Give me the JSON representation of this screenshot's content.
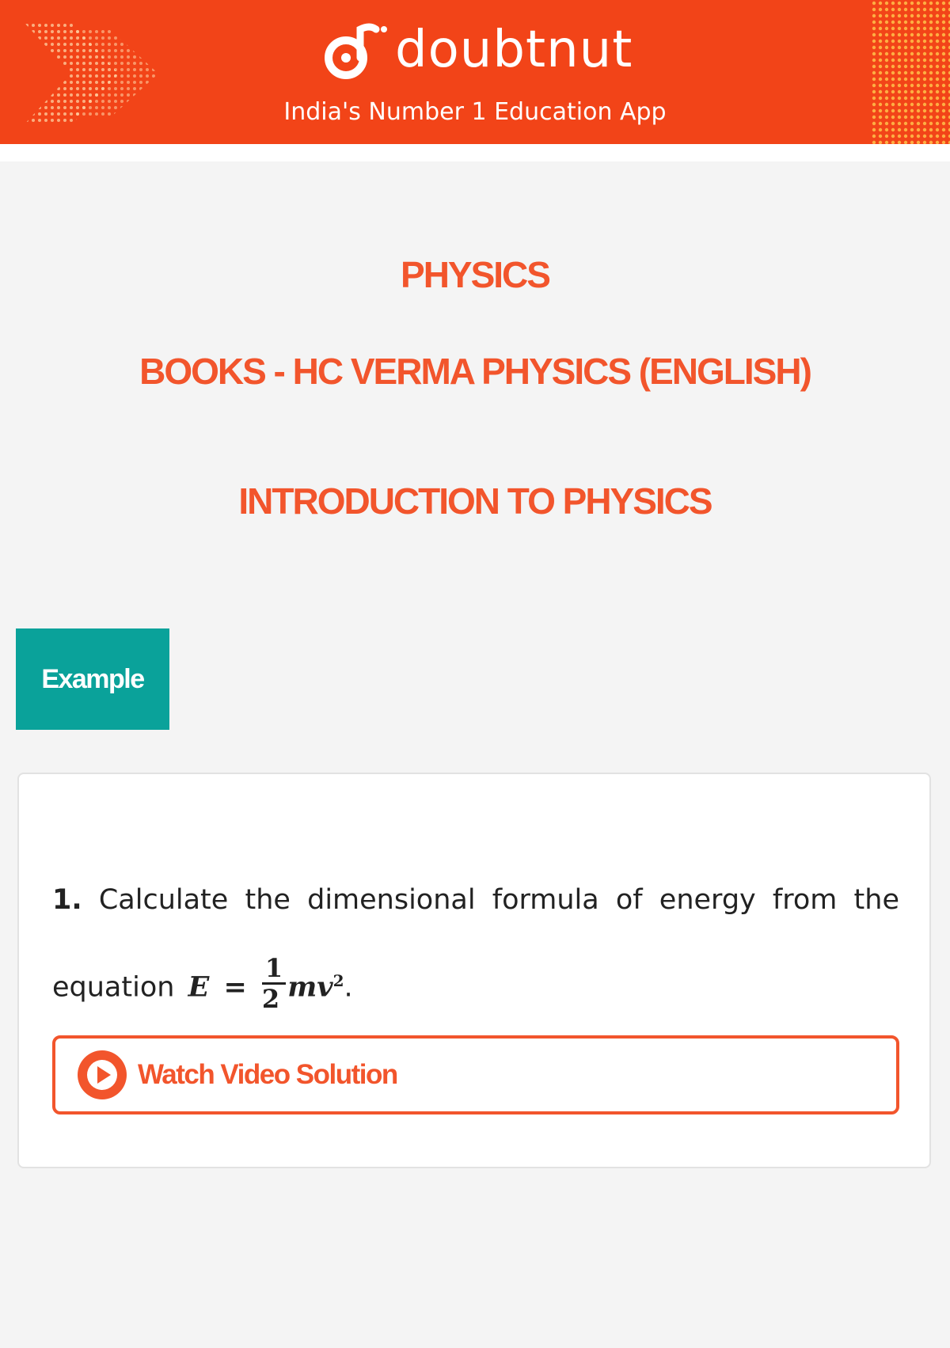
{
  "header": {
    "brand": "doubtnut",
    "tagline": "India's Number 1 Education App",
    "logo_icon": "doubtnut-logo-icon",
    "colors": {
      "header_bg": "#f24418",
      "accent": "#f2552c",
      "badge_bg": "#0aa29a"
    }
  },
  "titles": {
    "subject": "PHYSICS",
    "book": "BOOKS - HC VERMA PHYSICS (ENGLISH)",
    "chapter": "INTRODUCTION TO PHYSICS"
  },
  "section": {
    "label": "Example"
  },
  "question": {
    "number": "1.",
    "text": "Calculate the dimensional formula of energy from the equation",
    "equation_lhs": "E =",
    "fraction_num": "1",
    "fraction_den": "2",
    "equation_rhs": "mv",
    "exponent": "2",
    "end": "."
  },
  "action": {
    "label": "Watch Video Solution",
    "icon": "play-icon"
  }
}
